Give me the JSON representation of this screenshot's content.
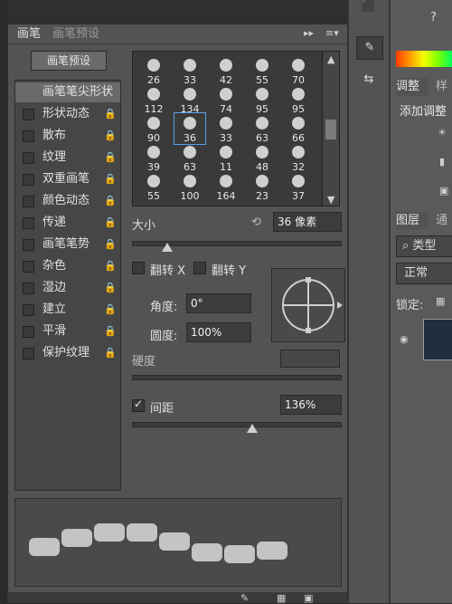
{
  "brush_panel": {
    "tabs": [
      "画笔",
      "画笔预设"
    ],
    "presets_button": "画笔预设",
    "left_items": [
      {
        "label": "画笔笔尖形状",
        "selected": true,
        "checkbox": false,
        "lock": false
      },
      {
        "label": "形状动态",
        "selected": false,
        "checkbox": true,
        "lock": true
      },
      {
        "label": "散布",
        "selected": false,
        "checkbox": true,
        "lock": true
      },
      {
        "label": "纹理",
        "selected": false,
        "checkbox": true,
        "lock": true
      },
      {
        "label": "双重画笔",
        "selected": false,
        "checkbox": true,
        "lock": true
      },
      {
        "label": "颜色动态",
        "selected": false,
        "checkbox": true,
        "lock": true
      },
      {
        "label": "传递",
        "selected": false,
        "checkbox": true,
        "lock": true
      },
      {
        "label": "画笔笔势",
        "selected": false,
        "checkbox": true,
        "lock": true
      },
      {
        "label": "杂色",
        "selected": false,
        "checkbox": true,
        "lock": true
      },
      {
        "label": "湿边",
        "selected": false,
        "checkbox": true,
        "lock": true
      },
      {
        "label": "建立",
        "selected": false,
        "checkbox": true,
        "lock": true
      },
      {
        "label": "平滑",
        "selected": false,
        "checkbox": true,
        "lock": true
      },
      {
        "label": "保护纹理",
        "selected": false,
        "checkbox": true,
        "lock": true
      }
    ],
    "brush_sizes_rows": [
      [
        "26",
        "33",
        "42",
        "55",
        "70"
      ],
      [
        "112",
        "134",
        "74",
        "95",
        "95"
      ],
      [
        "90",
        "36",
        "33",
        "63",
        "66"
      ],
      [
        "39",
        "63",
        "11",
        "48",
        "32"
      ],
      [
        "55",
        "100",
        "164",
        "23",
        "37"
      ]
    ],
    "selected_brush_index": 11,
    "size_label": "大小",
    "size_value": "36 像素",
    "flip_x": "翻转 X",
    "flip_y": "翻转 Y",
    "angle_label": "角度:",
    "angle_value": "0°",
    "roundness_label": "圆度:",
    "roundness_value": "100%",
    "hardness_label": "硬度",
    "spacing_label": "间距",
    "spacing_value": "136%",
    "spacing_checked": true
  },
  "right_panels": {
    "adjust_tabs": [
      "调整",
      "样"
    ],
    "add_adjust": "添加调整",
    "layers_tabs": [
      "图层",
      "通"
    ],
    "search_kind": "类型",
    "blend_mode": "正常",
    "lock_label": "锁定:"
  },
  "colors": {
    "accent": "#5aa0e8"
  }
}
